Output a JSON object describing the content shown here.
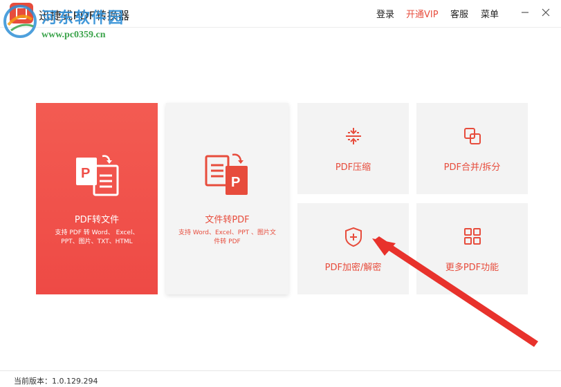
{
  "app": {
    "title": "迅捷式PDF转换器"
  },
  "watermark": {
    "site_name": "河东软件园",
    "url": "www.pc0359.cn"
  },
  "menu": {
    "login": "登录",
    "vip": "开通VIP",
    "service": "客服",
    "options": "菜单"
  },
  "tiles": {
    "pdf_to_file": {
      "label": "PDF转文件",
      "desc_line1": "支持 PDF 转 Word、 Excel、",
      "desc_line2": "PPT、图片、TXT、HTML"
    },
    "file_to_pdf": {
      "label": "文件转PDF",
      "desc_line1": "支持 Word、Excel、PPT 、图片文",
      "desc_line2": "件转 PDF"
    },
    "compress": {
      "label": "PDF压缩"
    },
    "merge_split": {
      "label": "PDF合并/拆分"
    },
    "encrypt": {
      "label": "PDF加密/解密"
    },
    "more": {
      "label": "更多PDF功能"
    }
  },
  "status": {
    "version": "当前版本：1.0.129.294"
  },
  "colors": {
    "accent": "#e74c3c",
    "tile_bg": "#f3f3f3",
    "annotation_arrow": "#e8322c"
  },
  "icons": {
    "compress": "compress-icon",
    "merge_split": "merge-split-icon",
    "encrypt": "shield-plus-icon",
    "more": "grid-icon",
    "pdf_to_file": "pdf-to-doc-icon",
    "file_to_pdf": "doc-to-pdf-icon"
  }
}
